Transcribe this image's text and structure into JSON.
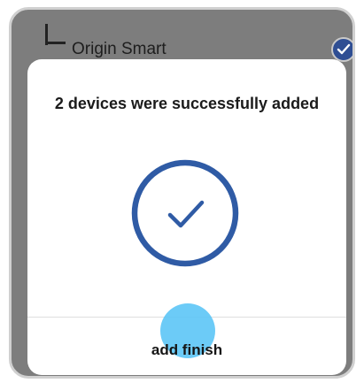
{
  "background": {
    "device": {
      "name": "Origin Smart",
      "icon": "device-glyph-icon",
      "selected": true
    }
  },
  "dialog": {
    "title": "2 devices were successfully added",
    "status_icon": "check-circle-icon",
    "finish_label": "add finish"
  },
  "colors": {
    "accent": "#2F5BA5",
    "badge": "#2F4E93",
    "tap_indicator": "#58C4F6",
    "overlay": "#7D7D7D"
  }
}
